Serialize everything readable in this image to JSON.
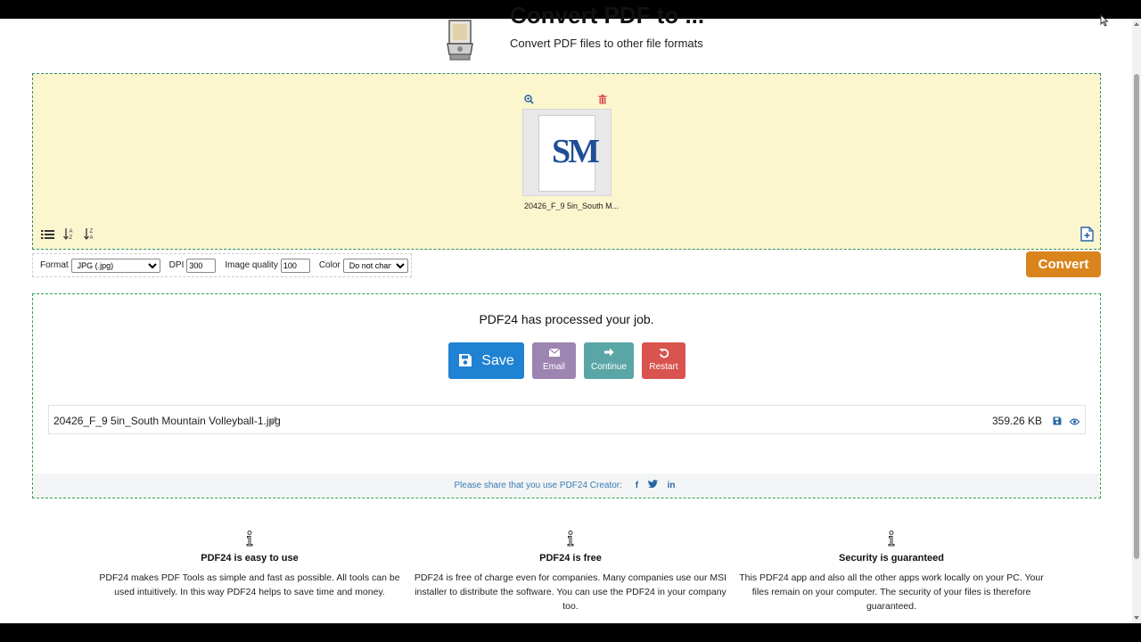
{
  "header": {
    "title": "Convert PDF to ...",
    "subtitle": "Convert PDF files to other file formats"
  },
  "dropzone": {
    "file_label": "20426_F_9 5in_South M..."
  },
  "options": {
    "format_label": "Format",
    "format_value": "JPG (.jpg)",
    "dpi_label": "DPI",
    "dpi_value": "300",
    "quality_label": "Image quality",
    "quality_value": "100",
    "color_label": "Color",
    "color_value": "Do not change"
  },
  "convert_label": "Convert",
  "result": {
    "title": "PDF24 has processed your job.",
    "save_label": "Save",
    "email_label": "Email",
    "continue_label": "Continue",
    "restart_label": "Restart",
    "file_name": "20426_F_9 5in_South Mountain Volleyball-1.jpg",
    "file_size": "359.26 KB",
    "share_text": "Please share that you use PDF24 Creator:"
  },
  "features": [
    {
      "title": "PDF24 is easy to use",
      "text": "PDF24 makes PDF Tools as simple and fast as possible. All tools can be used intuitively. In this way PDF24 helps to save time and money."
    },
    {
      "title": "PDF24 is free",
      "text": "PDF24 is free of charge even for companies. Many companies use our MSI installer to distribute the software. You can use the PDF24 in your company too."
    },
    {
      "title": "Security is guaranteed",
      "text": "This PDF24 app and also all the other apps work locally on your PC. Your files remain on your computer. The security of your files is therefore guaranteed."
    }
  ],
  "colors": {
    "accent_orange": "#d9841c",
    "save_blue": "#1f82d2",
    "email_purple": "#9d85b2",
    "continue_teal": "#5aa6a6",
    "restart_red": "#d9534f",
    "dropzone_bg": "#fcf6cf"
  },
  "icons": [
    "blender-logo-icon",
    "zoom-icon",
    "trash-icon",
    "list-view-icon",
    "sort-az-icon",
    "sort-za-icon",
    "add-file-icon",
    "save-icon",
    "email-icon",
    "arrow-right-icon",
    "restart-icon",
    "pencil-icon",
    "eye-icon",
    "facebook-icon",
    "twitter-icon",
    "linkedin-icon",
    "info-icon"
  ]
}
